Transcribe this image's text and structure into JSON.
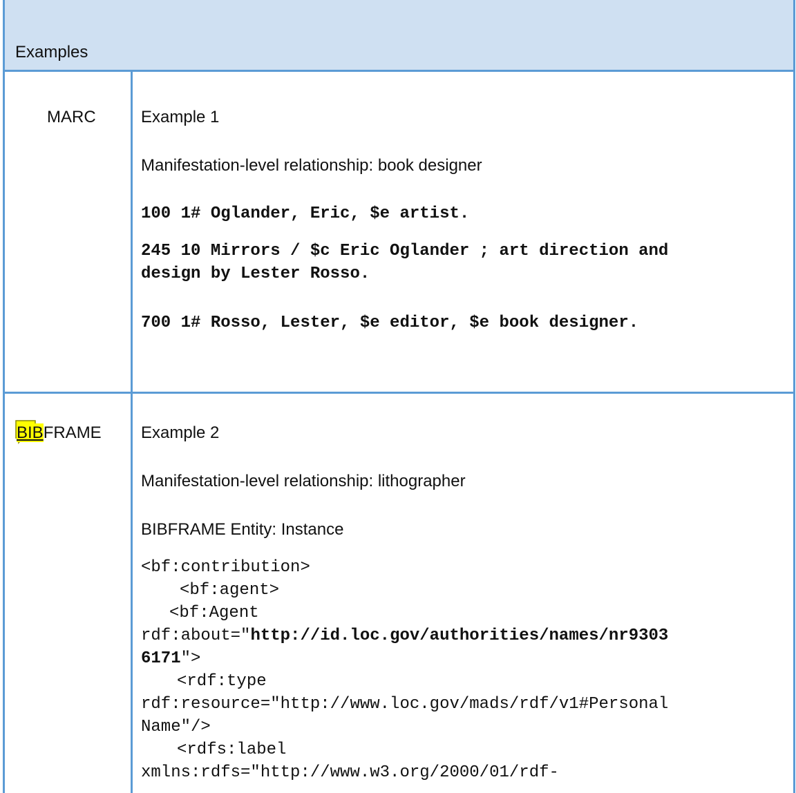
{
  "header": {
    "title": "Examples"
  },
  "rows": [
    {
      "label": "MARC",
      "example_title": "Example 1",
      "relationship": "Manifestation-level relationship: book designer",
      "fields": [
        "100 1# Oglander, Eric, $e artist.",
        "245 10 Mirrors / $c Eric Oglander ; art direction and",
        "design by Lester Rosso.",
        "700 1# Rosso, Lester, $e editor, $e book designer."
      ]
    },
    {
      "label_highlight": "BIB",
      "label_rest": "FRAME",
      "example_title": "Example 2",
      "relationship": "Manifestation-level relationship: lithographer",
      "entity": "BIBFRAME Entity: Instance",
      "code": {
        "l1": "<bf:contribution>",
        "l2": "<bf:agent>",
        "l3": "<bf:Agent",
        "l4_prefix": "rdf:about=\"",
        "l4_bold": "http://id.loc.gov/authorities/names/nr9303",
        "l5_bold": "6171",
        "l5_suffix": "\">",
        "l6": "<rdf:type",
        "l7": "rdf:resource=\"http://www.loc.gov/mads/rdf/v1#Personal",
        "l8": "Name\"/>",
        "l9": "<rdfs:label",
        "l10": "xmlns:rdfs=\"http://www.w3.org/2000/01/rdf-"
      }
    }
  ],
  "colors": {
    "border": "#5b9bd5",
    "header_bg": "#cfe0f2",
    "highlight": "#ffff00"
  }
}
